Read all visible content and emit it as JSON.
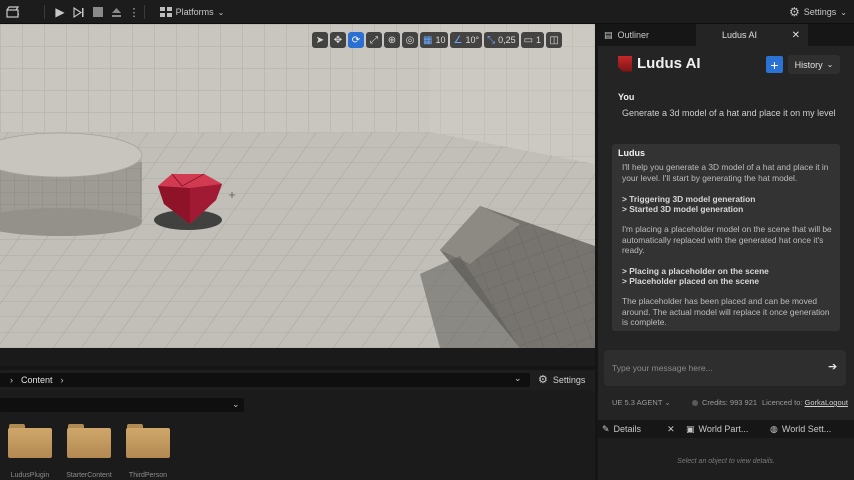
{
  "toolbar": {
    "platforms_label": "Platforms",
    "settings_label": "Settings"
  },
  "viewport": {
    "grid_snap_value": "10",
    "rotation_snap_value": "10°",
    "scale_snap_value": "0,25",
    "camera_speed_value": "1"
  },
  "content_browser": {
    "path_root": "Content",
    "settings_label": "Settings",
    "folders": [
      {
        "label": "LudusPlugin"
      },
      {
        "label": "StarterContent"
      },
      {
        "label": "ThirdPerson"
      }
    ]
  },
  "right_panel": {
    "tabs": {
      "outliner": "Outliner",
      "ludus": "Ludus AI"
    },
    "brand": "Ludus AI",
    "history_label": "History",
    "user_name": "You",
    "user_message": "Generate a 3d model of a hat and place it on my level",
    "bot_name": "Ludus",
    "bot_paragraphs": [
      "I'll help you generate a 3D model of a hat and place it in your level. I'll start by generating the hat model.",
      "> Triggering 3D model generation",
      "> Started 3D model generation",
      "I'm placing a placeholder model on the scene that will be automatically replaced with the generated hat once it's ready.",
      "> Placing a placeholder on the scene",
      "> Placeholder placed on the scene",
      "The placeholder has been placed and can be moved around. The actual model will replace it once generation is complete."
    ],
    "input_placeholder": "Type your message here...",
    "agent_label": "UE 5.3 AGENT",
    "credits_text": "Credits: 993 921",
    "licensed_text": "Licenced to: ",
    "licensed_user": "Gorka",
    "logout_label": "Logout"
  },
  "details": {
    "tabs": [
      "Details",
      "World Part...",
      "World Sett..."
    ],
    "hint": "Select an object to view details."
  },
  "colors": {
    "accent_blue": "#2a72d4",
    "play_green": "#5cc24b",
    "brand_red": "#c62828"
  }
}
